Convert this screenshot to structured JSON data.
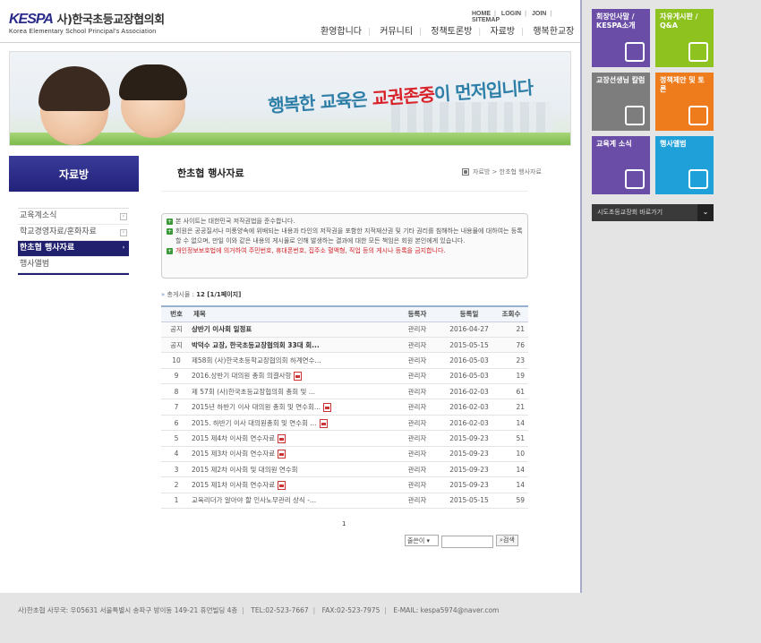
{
  "logo": {
    "mark": "KESPA",
    "name": "사)한국초등교장협의회",
    "sub": "Korea Elementary School Principal's Association"
  },
  "util_links": [
    "HOME",
    "LOGIN",
    "JOIN",
    "SITEMAP"
  ],
  "gnb": [
    "환영합니다",
    "커뮤니티",
    "정책토론방",
    "자료방",
    "행복한교장"
  ],
  "banner": {
    "slogan_pre": "행복한 교육은 ",
    "slogan_hl": "교권존중",
    "slogan_post": "이 먼저입니다"
  },
  "lnb": {
    "title": "자료방",
    "items": [
      {
        "label": "교육계소식"
      },
      {
        "label": "학교경영자료/훈화자료"
      },
      {
        "label": "한초협 행사자료"
      },
      {
        "label": "행사앨범"
      }
    ]
  },
  "content": {
    "title": "한초협 행사자료",
    "breadcrumb": "자료방 > 한초협 행사자료"
  },
  "notice_box": [
    "본 사이트는 대한민국 저작권법을 준수합니다.",
    "회원은 공공질서나 미풍양속에 위배되는 내용과 타인의 저작권을 포함한 지적재산권 및 기타 권리를 침해하는 내용물에 대하여는 등록할 수 없으며, 만일 이와 같은 내용의 게시물로 인해 발생하는 결과에 대한 모든 책임은 회원 본인에게 있습니다.",
    "개인정보보호법에 의거하여 주민번호, 휴대폰번호, 집주소 혈액형, 직업 등의 게시나 등록을 금지합니다."
  ],
  "board": {
    "total_label": "총게시물 :",
    "total_value": "12 [1/1페이지]",
    "headers": {
      "no": "번호",
      "subject": "제목",
      "writer": "등록자",
      "date": "등록일",
      "views": "조회수"
    },
    "rows": [
      {
        "no": "공지",
        "subject": "상반기 이사회 일정표",
        "writer": "관리자",
        "date": "2016-04-27",
        "views": "21",
        "pdf": false,
        "notice": true
      },
      {
        "no": "공지",
        "subject": "박덕수 교장, 한국초등교장협의회 33대 회...",
        "writer": "관리자",
        "date": "2015-05-15",
        "views": "76",
        "pdf": false,
        "notice": true
      },
      {
        "no": "10",
        "subject": "제58회 (사)한국초등학교장협의회 하계연수...",
        "writer": "관리자",
        "date": "2016-05-03",
        "views": "23",
        "pdf": false,
        "notice": false
      },
      {
        "no": "9",
        "subject": "2016.상반기 대의원 총회 의결사항",
        "writer": "관리자",
        "date": "2016-05-03",
        "views": "19",
        "pdf": true,
        "notice": false
      },
      {
        "no": "8",
        "subject": "제 57회 (사)한국초등교장협의회 총회 및 ...",
        "writer": "관리자",
        "date": "2016-02-03",
        "views": "61",
        "pdf": false,
        "notice": false
      },
      {
        "no": "7",
        "subject": "2015년 하반기 이사 대의원 총회 및 연수회...",
        "writer": "관리자",
        "date": "2016-02-03",
        "views": "21",
        "pdf": true,
        "notice": false
      },
      {
        "no": "6",
        "subject": "2015. 하반기 이사 대의원총회 및 연수회 ...",
        "writer": "관리자",
        "date": "2016-02-03",
        "views": "14",
        "pdf": true,
        "notice": false
      },
      {
        "no": "5",
        "subject": "2015 제4차 이사회 연수자료",
        "writer": "관리자",
        "date": "2015-09-23",
        "views": "51",
        "pdf": true,
        "notice": false
      },
      {
        "no": "4",
        "subject": "2015 제3차 이사회 연수자료",
        "writer": "관리자",
        "date": "2015-09-23",
        "views": "10",
        "pdf": true,
        "notice": false
      },
      {
        "no": "3",
        "subject": "2015 제2차 이사회 및 대의원 연수회",
        "writer": "관리자",
        "date": "2015-09-23",
        "views": "14",
        "pdf": false,
        "notice": false
      },
      {
        "no": "2",
        "subject": "2015 제1차 이사회 연수자료",
        "writer": "관리자",
        "date": "2015-09-23",
        "views": "14",
        "pdf": true,
        "notice": false
      },
      {
        "no": "1",
        "subject": "교육리더가 알아야 할 인사노무관리 상식 -...",
        "writer": "관리자",
        "date": "2015-05-15",
        "views": "59",
        "pdf": false,
        "notice": false
      }
    ],
    "page": "1",
    "search_select": "줄쓴이 ▾",
    "search_button": "검색"
  },
  "quick": [
    {
      "label": "회장인사말 / KESPA소개",
      "icon": "pen-icon",
      "color": "#6a4da6"
    },
    {
      "label": "자유게시판 / Q&A",
      "icon": "envelope-icon",
      "color": "#8dc21f"
    },
    {
      "label": "교장선생님 칼럼",
      "icon": "clipboard-icon",
      "color": "#7d7d7d"
    },
    {
      "label": "정책제안 및 토론",
      "icon": "presentation-icon",
      "color": "#ee7b1c"
    },
    {
      "label": "교육계 소식",
      "icon": "chart-icon",
      "color": "#6a4da6"
    },
    {
      "label": "행사앨범",
      "icon": "calendar-icon",
      "color": "#20a0d8"
    }
  ],
  "shortcut": "시도초등교장회 바로가기",
  "footer": {
    "address": "사)한초협 사무국: 우05631 서울특별시 송파구 방이동 149-21 휴먼빌딩 4층",
    "tel": "TEL:02-523-7667",
    "fax": "FAX:02-523-7975",
    "email": "E-MAIL: kespa5974@naver.com"
  }
}
